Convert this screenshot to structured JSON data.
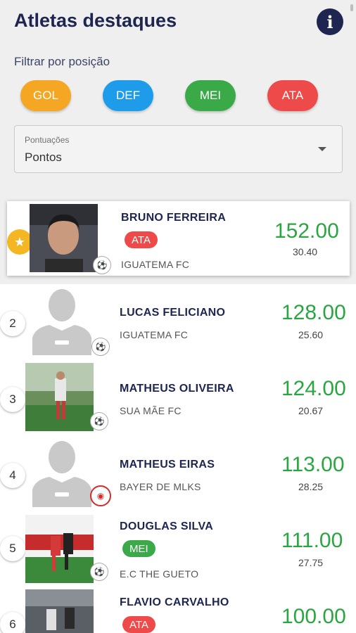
{
  "header": {
    "title": "Atletas destaques",
    "info_icon": "info-icon"
  },
  "filter": {
    "label": "Filtrar por posição",
    "chips": [
      {
        "label": "GOL",
        "color": "#f5a623"
      },
      {
        "label": "DEF",
        "color": "#1e9be9"
      },
      {
        "label": "MEI",
        "color": "#3aaa48"
      },
      {
        "label": "ATA",
        "color": "#ef4a4a"
      }
    ]
  },
  "sort_select": {
    "label": "Pontuações",
    "value": "Pontos"
  },
  "colors": {
    "accent": "#1d2550",
    "points": "#2aa640",
    "star": "#f5b624"
  },
  "athletes": [
    {
      "rank": "",
      "rank_icon": "star-icon",
      "name": "BRUNO FERREIRA",
      "position": "ATA",
      "position_color": "#ef4a4a",
      "team": "IGUATEMA FC",
      "points": "152.00",
      "average": "30.40",
      "photo": "player-photo"
    },
    {
      "rank": "2",
      "name": "LUCAS FELICIANO",
      "position": "",
      "team": "IGUATEMA FC",
      "points": "128.00",
      "average": "25.60",
      "photo": "placeholder-avatar-icon"
    },
    {
      "rank": "3",
      "name": "MATHEUS OLIVEIRA",
      "position": "",
      "team": "SUA MÃE FC",
      "points": "124.00",
      "average": "20.67",
      "photo": "player-photo"
    },
    {
      "rank": "4",
      "name": "MATHEUS EIRAS",
      "position": "",
      "team": "BAYER DE MLKS",
      "points": "113.00",
      "average": "28.25",
      "photo": "placeholder-avatar-icon"
    },
    {
      "rank": "5",
      "name": "DOUGLAS SILVA",
      "position": "MEI",
      "position_color": "#3aaa48",
      "team": "E.C THE GUETO",
      "points": "111.00",
      "average": "27.75",
      "photo": "player-photo"
    },
    {
      "rank": "6",
      "name": "FLAVIO CARVALHO",
      "position": "ATA",
      "position_color": "#ef4a4a",
      "team": "",
      "points": "100.00",
      "average": "",
      "photo": "player-photo"
    }
  ]
}
